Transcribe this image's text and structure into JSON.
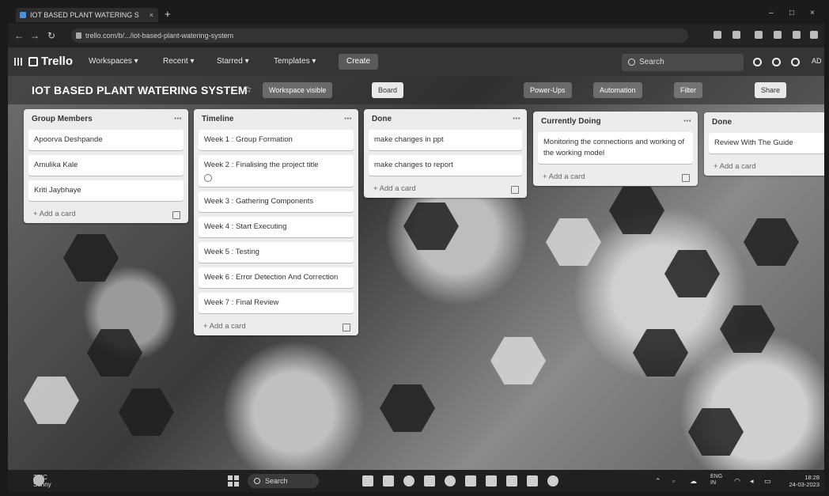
{
  "browser": {
    "tab_title": "IOT BASED PLANT WATERING S",
    "tab_close": "×",
    "new_tab": "+",
    "url": "trello.com/b/.../iot-based-plant-watering-system",
    "win_min": "–",
    "win_max": "□",
    "win_close": "×",
    "back": "←",
    "forward": "→",
    "reload": "↻"
  },
  "trello": {
    "logo": "Trello",
    "nav": [
      "Workspaces ▾",
      "Recent ▾",
      "Starred ▾",
      "Templates ▾"
    ],
    "create": "Create",
    "search_placeholder": "Search",
    "avatar": "AD"
  },
  "board": {
    "title": "IOT BASED PLANT WATERING SYSTEM",
    "star": "☆",
    "visibility": "Workspace visible",
    "view": "Board",
    "power_ups": "Power-Ups",
    "automation": "Automation",
    "filter": "Filter",
    "share": "Share",
    "lists": [
      {
        "title": "Group Members",
        "cards": [
          "Apoorva Deshpande",
          "Amulika Kale",
          "Kriti Jaybhaye"
        ],
        "add": "+ Add a card"
      },
      {
        "title": "Timeline",
        "cards": [
          "Week 1 : Group Formation",
          "Week 2 : Finalising the project title",
          "Week 3 : Gathering Components",
          "Week 4 : Start Executing",
          "Week 5 : Testing",
          "Week 6 : Error Detection And Correction",
          "Week 7 : Final Review"
        ],
        "add": "+ Add a card"
      },
      {
        "title": "Done",
        "cards": [
          "make changes in ppt",
          "make changes to report"
        ],
        "add": "+ Add a card"
      },
      {
        "title": "Currently Doing",
        "cards": [
          "Monitoring the connections and working of the working model"
        ],
        "add": "+ Add a card"
      },
      {
        "title": "Done",
        "cards": [
          "Review With The Guide"
        ],
        "add": "+ Add a card"
      }
    ]
  },
  "taskbar": {
    "weather_temp": "30°C",
    "weather_desc": "Sunny",
    "search": "Search",
    "lang_top": "ENG",
    "lang_bottom": "IN",
    "time": "18:28",
    "date": "24-03-2023"
  }
}
